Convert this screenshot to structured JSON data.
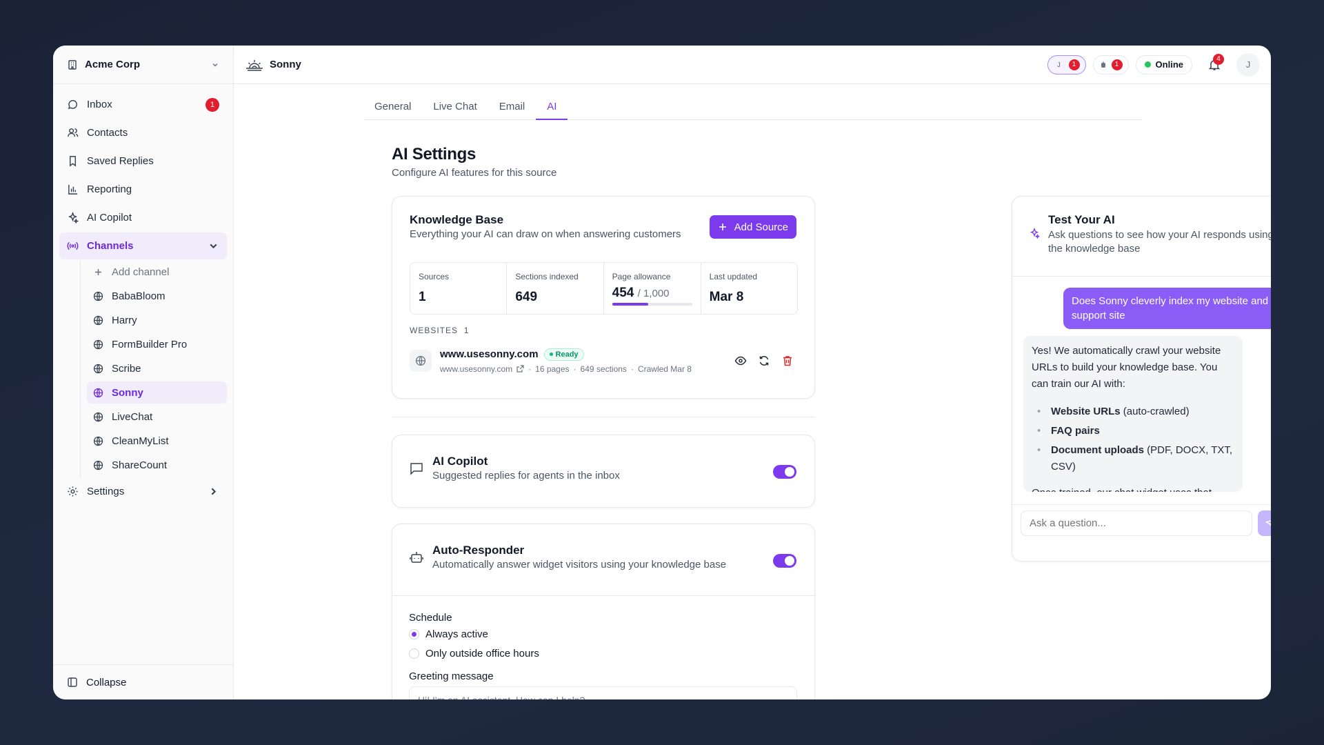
{
  "workspace": {
    "name": "Acme Corp"
  },
  "nav": {
    "inbox": {
      "label": "Inbox",
      "badge": "1"
    },
    "contacts": {
      "label": "Contacts"
    },
    "saved_replies": {
      "label": "Saved Replies"
    },
    "reporting": {
      "label": "Reporting"
    },
    "ai_copilot": {
      "label": "AI Copilot"
    },
    "channels": {
      "label": "Channels"
    },
    "settings": {
      "label": "Settings"
    },
    "collapse": {
      "label": "Collapse"
    }
  },
  "channels": {
    "add_label": "Add channel",
    "items": [
      "BabaBloom",
      "Harry",
      "FormBuilder Pro",
      "Scribe",
      "Sonny",
      "LiveChat",
      "CleanMyList",
      "ShareCount"
    ],
    "active": "Sonny"
  },
  "topbar": {
    "title": "Sonny",
    "pill1": {
      "initial": "J",
      "count": "1"
    },
    "pill2": {
      "count": "1"
    },
    "status": "Online",
    "notifications": "4",
    "avatar": "J"
  },
  "tabs": [
    "General",
    "Live Chat",
    "Email",
    "AI"
  ],
  "active_tab": "AI",
  "page": {
    "title": "AI Settings",
    "subtitle": "Configure AI features for this source"
  },
  "knowledge_base": {
    "title": "Knowledge Base",
    "desc": "Everything your AI can draw on when answering customers",
    "add_button": "Add Source",
    "stats": {
      "sources_label": "Sources",
      "sources": "1",
      "sections_label": "Sections indexed",
      "sections": "649",
      "allowance_label": "Page allowance",
      "allowance_used": "454",
      "allowance_total": "/ 1,000",
      "allowance_fraction": 0.454,
      "updated_label": "Last updated",
      "updated": "Mar 8"
    },
    "websites_caption": "WEBSITES",
    "websites_count": "1",
    "site": {
      "name": "www.usesonny.com",
      "status": "Ready",
      "url": "www.usesonny.com",
      "pages": "16 pages",
      "sections": "649 sections",
      "crawled": "Crawled Mar 8"
    }
  },
  "copilot_card": {
    "title": "AI Copilot",
    "desc": "Suggested replies for agents in the inbox",
    "enabled": true
  },
  "auto_card": {
    "title": "Auto-Responder",
    "desc": "Automatically answer widget visitors using your knowledge base",
    "enabled": true,
    "schedule_label": "Schedule",
    "option_always": "Always active",
    "option_outside": "Only outside office hours",
    "greeting_label": "Greeting message",
    "greeting_placeholder": "Hi! I'm an AI assistant. How can I help?"
  },
  "test_ai": {
    "title": "Test Your AI",
    "desc": "Ask questions to see how your AI responds using the knowledge base",
    "user_message": "Does Sonny cleverly index my website and support site",
    "bot_intro": "Yes! We automatically crawl your website URLs to build your knowledge base. You can train our AI with:",
    "bullets": [
      {
        "bold": "Website URLs",
        "rest": " (auto-crawled)"
      },
      {
        "bold": "FAQ pairs",
        "rest": ""
      },
      {
        "bold": "Document uploads",
        "rest": " (PDF, DOCX, TXT, CSV)"
      }
    ],
    "bot_outro": "Once trained, our chat widget uses that",
    "input_placeholder": "Ask a question..."
  },
  "colors": {
    "accent": "#7c3aed",
    "badge": "#e11d2e",
    "online": "#22c55e"
  }
}
